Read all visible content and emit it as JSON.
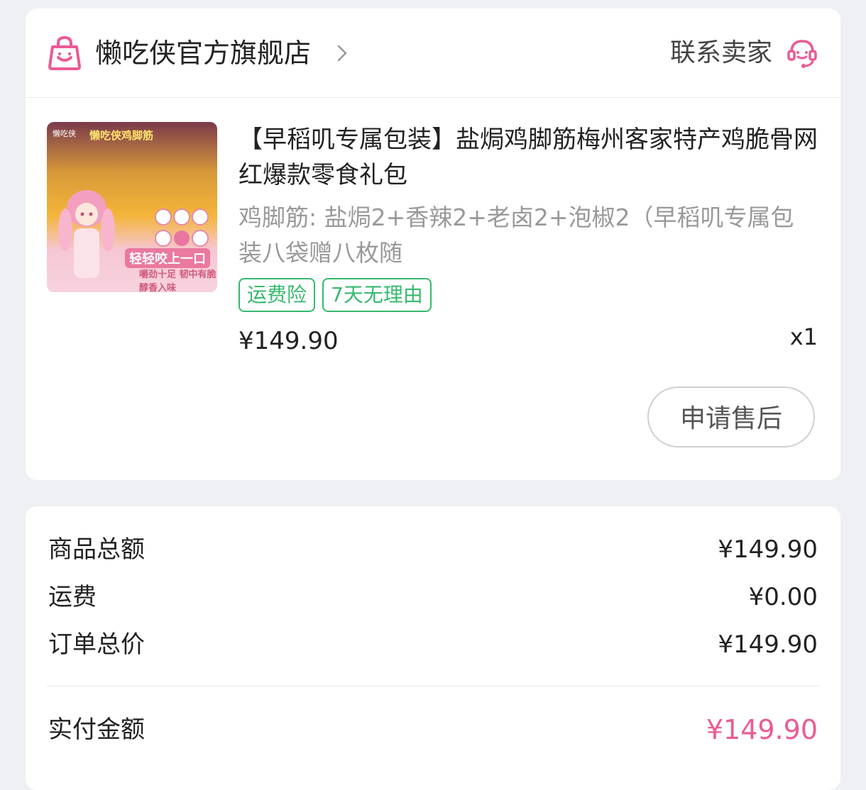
{
  "store": {
    "name": "懒吃侠官方旗舰店",
    "contact_label": "联系卖家"
  },
  "product": {
    "title": "【早稻叽专属包装】盐焗鸡脚筋梅州客家特产鸡脆骨网红爆款零食礼包",
    "spec": "鸡脚筋: 盐焗2+香辣2+老卤2+泡椒2（早稻叽专属包装八袋赠八枚随",
    "tags": [
      "运费险",
      "7天无理由"
    ],
    "price": "¥149.90",
    "quantity": "x1",
    "after_sale_label": "申请售后",
    "image_text": {
      "brand": "懒吃侠",
      "headline": "懒吃侠鸡脚筋",
      "slogan": "轻轻咬上一口",
      "foot": "嚼劲十足 韧中有脆 醇香入味"
    }
  },
  "summary": {
    "items_total_label": "商品总额",
    "items_total_value": "¥149.90",
    "shipping_label": "运费",
    "shipping_value": "¥0.00",
    "order_total_label": "订单总价",
    "order_total_value": "¥149.90",
    "paid_label": "实付金额",
    "paid_value": "¥149.90"
  },
  "colors": {
    "accent_pink": "#ec5a95",
    "tag_green": "#36b96e",
    "background": "#eff0f4"
  },
  "icons": {
    "store": "shopping-bag-icon",
    "chevron": "chevron-right-icon",
    "service": "customer-service-icon"
  }
}
